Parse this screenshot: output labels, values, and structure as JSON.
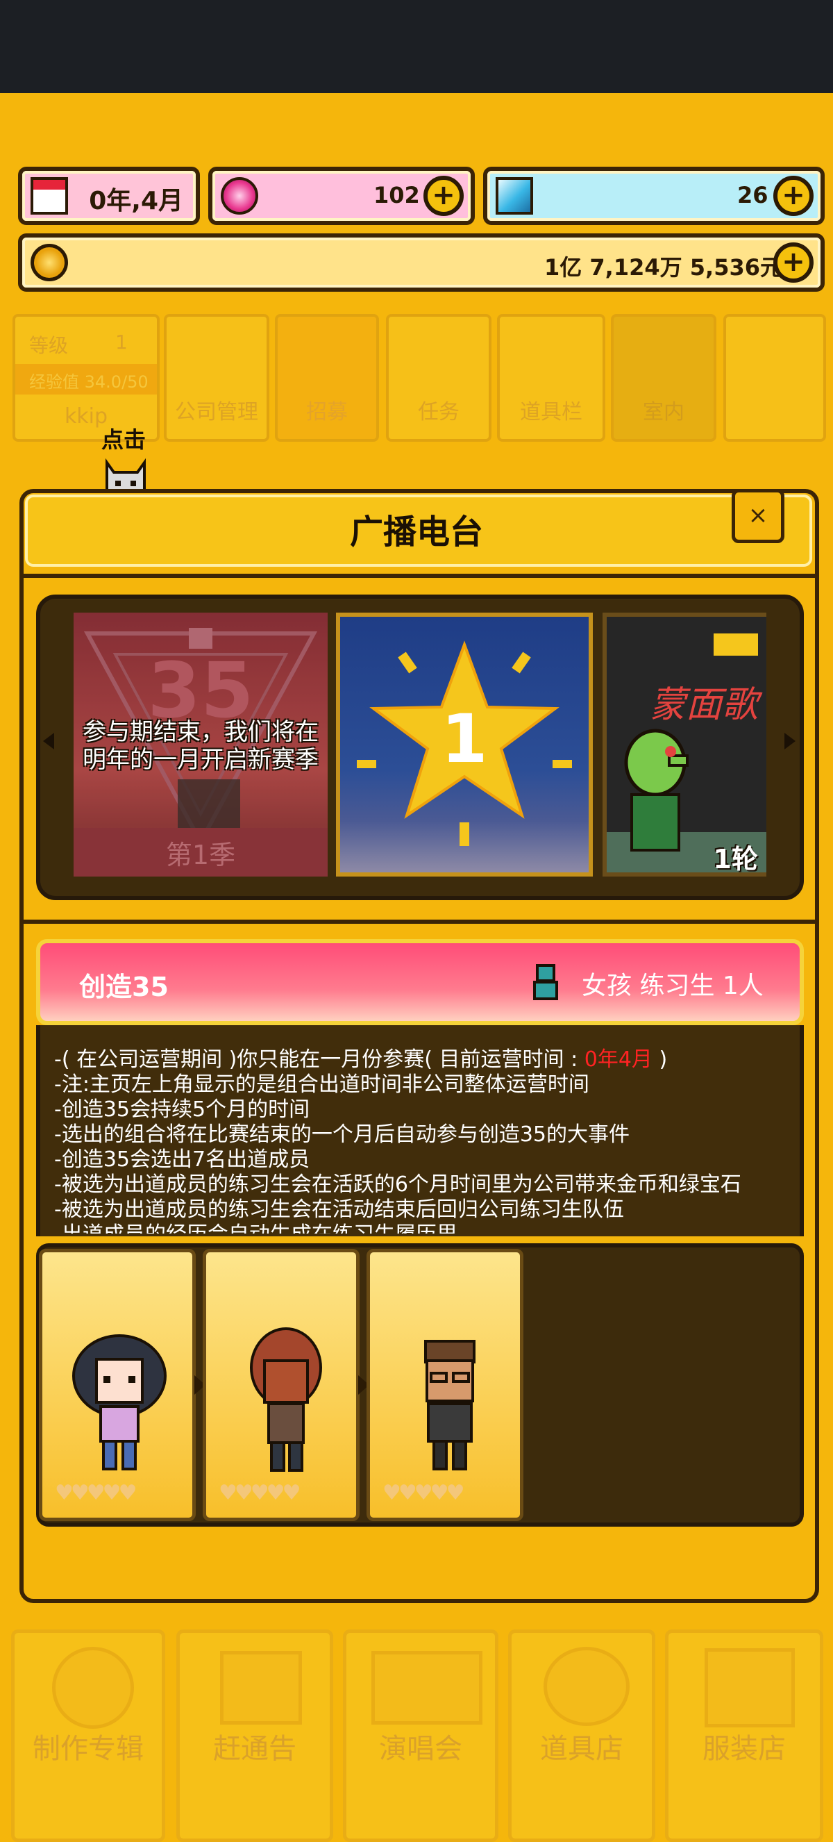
{
  "top_bar": {
    "date": "0年,4月",
    "gems": "102",
    "diamonds": "26",
    "money": "1亿 7,124万 5,536元",
    "date_icon": "calendar-icon",
    "gem_icon": "pink-gem-icon",
    "diamond_icon": "blue-diamond-icon",
    "coin_icon": "coin-icon"
  },
  "background_menu": {
    "level_label": "等级",
    "level_value": "1",
    "exp_label": "经验值 34.0/50",
    "company_name": "kkip",
    "tabs": [
      "公司管理",
      "招募",
      "任务",
      "道具栏",
      "室内"
    ],
    "tap_hint": "点击"
  },
  "panel": {
    "title": "广播电台",
    "close_symbol": "×"
  },
  "carousel": {
    "card1_overlay": "参与期结束，我们将在\n明年的一月开启新赛季",
    "card1_number": "35",
    "card1_season": "第1季",
    "card2_number": "1",
    "card3_title": "蒙面歌",
    "card3_round": "1轮"
  },
  "event": {
    "name": "创造35",
    "recruit": "女孩 练习生 1人",
    "lines": [
      {
        "pre": "-( 在公司运营期间 )你只能在一月份参赛( 目前运营时间 : ",
        "highlight": "0年4月",
        "post": " )"
      },
      {
        "pre": "-注:主页左上角显示的是组合出道时间非公司整体运营时间",
        "highlight": "",
        "post": ""
      },
      {
        "pre": "-创造35会持续5个月的时间",
        "highlight": "",
        "post": ""
      },
      {
        "pre": "-选出的组合将在比赛结束的一个月后自动参与创造35的大事件",
        "highlight": "",
        "post": ""
      },
      {
        "pre": "-创造35会选出7名出道成员",
        "highlight": "",
        "post": ""
      },
      {
        "pre": "-被选为出道成员的练习生会在活跃的6个月时间里为公司带来金币和绿宝石",
        "highlight": "",
        "post": ""
      },
      {
        "pre": "-被选为出道成员的练习生会在活动结束后回归公司练习生队伍",
        "highlight": "",
        "post": ""
      },
      {
        "pre": "-出道成员的经历会自动生成在练习生履历里",
        "highlight": "",
        "post": ""
      }
    ]
  },
  "members": {
    "hearts": "♥♥♥♥♥"
  },
  "bottom_menu": [
    "制作专辑",
    "赶通告",
    "演唱会",
    "道具店",
    "服装店"
  ],
  "colors": {
    "background": "#f5b60c",
    "dark_brown": "#3b2406",
    "banner_pink": "#ff4d78",
    "highlight_red": "#ff2323"
  }
}
